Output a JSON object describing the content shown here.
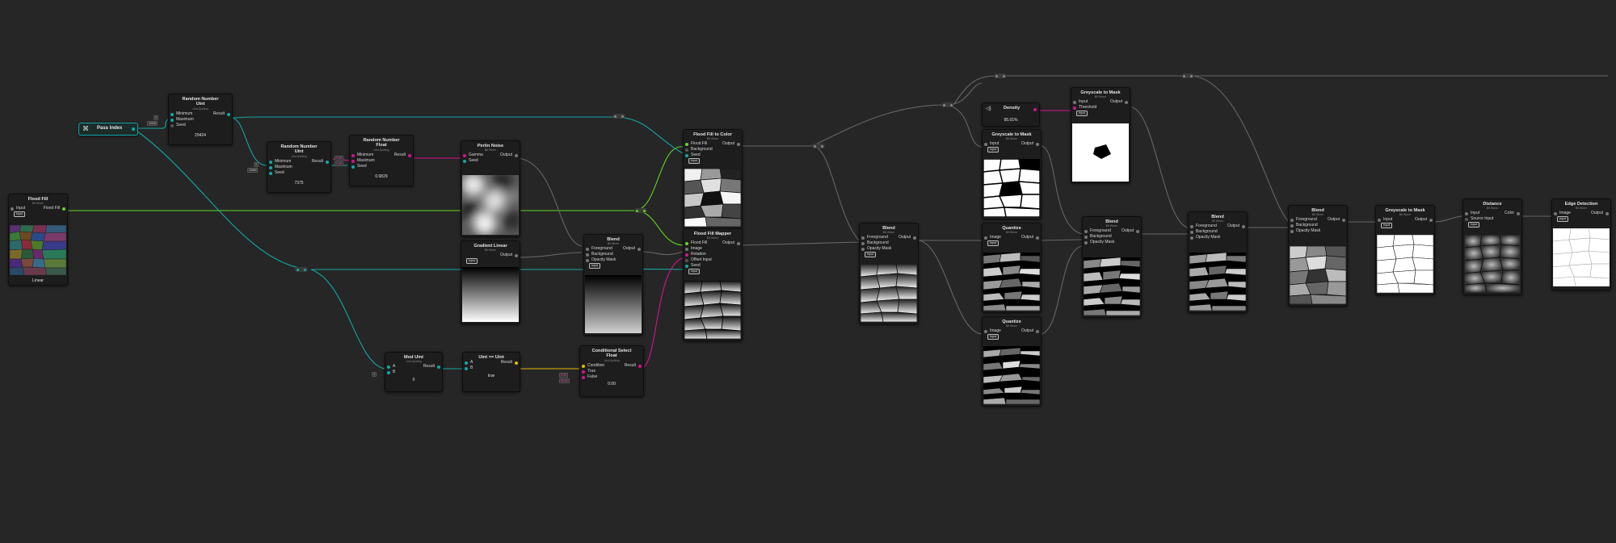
{
  "colors": {
    "float": "#d4148c",
    "uint": "#12a8a4",
    "bool": "#e6b800",
    "fill": "#5fd61e",
    "gray": "#7a7a7a",
    "canvas": "#262626"
  },
  "pass_index": {
    "title": "Pass Index"
  },
  "flood_fill_src": {
    "title": "Flood Fill",
    "sub": "Bit Worm",
    "input": "Input",
    "output": "Flood Fill",
    "badge": "Input",
    "caption": "Linear"
  },
  "rnu1": {
    "title_1": "Random Number",
    "title_2": "Uint",
    "sub": "Uint Quilting",
    "in": [
      "Minimum",
      "Maximum",
      "Seed"
    ],
    "out": "Result",
    "value": "29424",
    "in_values": [
      "0",
      "10000"
    ]
  },
  "rnu2": {
    "title_1": "Random Number",
    "title_2": "Uint",
    "sub": "Uint Quilting",
    "in": [
      "Minimum",
      "Maximum",
      "Seed"
    ],
    "out": "Result",
    "value": "7375",
    "in_values": [
      "0",
      "10000"
    ]
  },
  "rnf": {
    "title_1": "Random Number",
    "title_2": "Float",
    "sub": "Uint Quilting",
    "in": [
      "Minimum",
      "Maximum",
      "Seed"
    ],
    "out": "Result",
    "value": "0.6829",
    "in_values": [
      "0.45",
      "1.00"
    ]
  },
  "perlin": {
    "title": "Perlin Noise",
    "sub": "Bit Worm",
    "in": [
      "Gamma",
      "Seed"
    ],
    "out": "Output"
  },
  "gradient": {
    "title": "Gradient Linear",
    "sub": "Bit Worm",
    "out": "Output",
    "badge": "Input"
  },
  "blend_a": {
    "title": "Blend",
    "sub": "Bit Worm",
    "in": [
      "Foreground",
      "Background",
      "Opacity Mask"
    ],
    "out": "Output",
    "badge": "Input"
  },
  "ffc": {
    "title": "Flood Fill to Color",
    "sub": "Bit Worm",
    "in": [
      "Flood Fill",
      "Background",
      "Seed"
    ],
    "out": "Output",
    "badge": "Input"
  },
  "ffm": {
    "title": "Flood Fill Mapper",
    "sub": "Bit Worm",
    "in": [
      "Flood Fill",
      "Image",
      "Rotation",
      "Offset Input",
      "Seed"
    ],
    "out": "Output",
    "badge": "Input"
  },
  "mod": {
    "title": "Mod Uint",
    "sub": "Uint Quilting",
    "in": [
      "A",
      "B"
    ],
    "out": "Result",
    "value": "0",
    "in_values": [
      "3"
    ]
  },
  "eq": {
    "title": "Uint == Uint",
    "sub": "",
    "in": [
      "A",
      "B"
    ],
    "out": "Result",
    "value": "true"
  },
  "csf": {
    "title_1": "Conditional Select",
    "title_2": "Float",
    "sub": "Uint Quilting",
    "in": [
      "Condition",
      "True",
      "False"
    ],
    "out": "Result",
    "value": "0.00",
    "in_values": [
      "0.00",
      "90.00"
    ]
  },
  "blend_b": {
    "title": "Blend",
    "sub": "Bit Worm",
    "in": [
      "Foreground",
      "Background",
      "Opacity Mask"
    ],
    "out": "Output",
    "badge": "Input"
  },
  "density": {
    "title": "Density",
    "value": "95.01%"
  },
  "g2m_top": {
    "title": "Greyscale to Mask",
    "sub": "Bit Worm",
    "in": [
      "Input",
      "Threshold"
    ],
    "out": "Output",
    "badge": "Input"
  },
  "g2m_mid": {
    "title": "Greyscale to Mask",
    "sub": "Bit Worm",
    "in": [
      "Input"
    ],
    "out": "Output",
    "badge": "Input"
  },
  "quantize1": {
    "title": "Quantize",
    "sub": "Bit Worm",
    "in": [
      "Image"
    ],
    "out": "Output",
    "badge": "Input"
  },
  "quantize2": {
    "title": "Quantize",
    "sub": "Bit Worm",
    "in": [
      "Image"
    ],
    "out": "Output",
    "badge": "Input"
  },
  "blend_c": {
    "title": "Blend",
    "sub": "Bit Worm",
    "in": [
      "Foreground",
      "Background",
      "Opacity Mask"
    ],
    "out": "Output"
  },
  "blend_d": {
    "title": "Blend",
    "sub": "Bit Worm",
    "in": [
      "Foreground",
      "Background",
      "Opacity Mask"
    ],
    "out": "Output"
  },
  "blend_e": {
    "title": "Blend",
    "sub": "Bit Worm",
    "in": [
      "Foreground",
      "Background",
      "Opacity Mask"
    ],
    "out": "Output"
  },
  "g2m_right": {
    "title": "Greyscale to Mask",
    "sub": "Bit Worm",
    "in": [
      "Input"
    ],
    "out": "Output",
    "badge": "Input"
  },
  "distance": {
    "title": "Distance",
    "sub": "Bit Worm",
    "in": [
      "Input",
      "Source Input"
    ],
    "out": "Color",
    "badge": "Input"
  },
  "edge": {
    "title": "Edge Detection",
    "sub": "Bit Worm",
    "in": [
      "Image"
    ],
    "out": "Output",
    "badge": "Input"
  }
}
